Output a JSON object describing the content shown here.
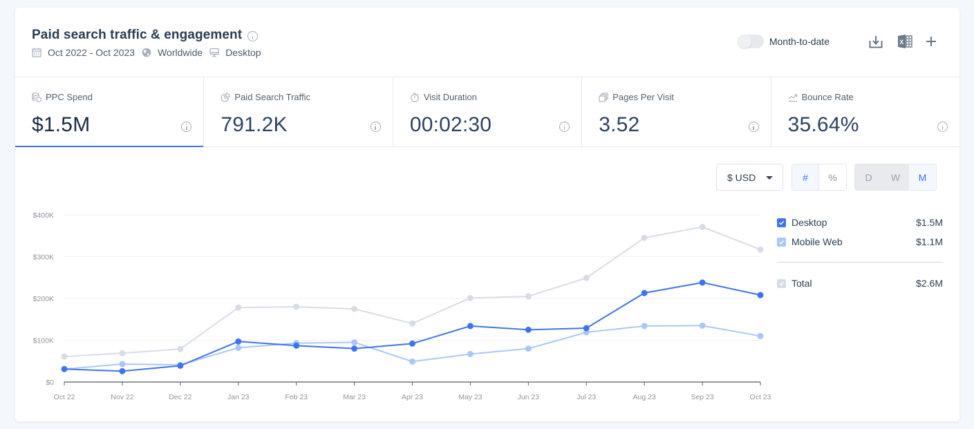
{
  "header": {
    "title": "Paid search traffic & engagement",
    "date_range": "Oct 2022 - Oct 2023",
    "region": "Worldwide",
    "device": "Desktop",
    "toggle_label": "Month-to-date",
    "toggle_on": false,
    "icons": [
      "info-icon",
      "calendar-icon",
      "globe-icon",
      "desktop-icon",
      "download-icon",
      "excel-icon",
      "plus-icon"
    ]
  },
  "metrics": [
    {
      "label": "PPC Spend",
      "value": "$1.5M",
      "icon": "coins-icon",
      "active": true
    },
    {
      "label": "Paid Search Traffic",
      "value": "791.2K",
      "icon": "pie-chart-icon",
      "active": false
    },
    {
      "label": "Visit Duration",
      "value": "00:02:30",
      "icon": "stopwatch-icon",
      "active": false
    },
    {
      "label": "Pages Per Visit",
      "value": "3.52",
      "icon": "pages-icon",
      "active": false
    },
    {
      "label": "Bounce Rate",
      "value": "35.64%",
      "icon": "trend-icon",
      "active": false
    }
  ],
  "controls": {
    "currency": "$ USD",
    "value_mode": [
      {
        "label": "#",
        "active": true
      },
      {
        "label": "%",
        "active": false
      }
    ],
    "granularity": [
      {
        "label": "D",
        "active": false
      },
      {
        "label": "W",
        "active": false
      },
      {
        "label": "M",
        "active": true
      }
    ]
  },
  "legend": [
    {
      "name": "Desktop",
      "value": "$1.5M",
      "checked": true,
      "color": "#3e74f0"
    },
    {
      "name": "Mobile Web",
      "value": "$1.1M",
      "checked": true,
      "color": "#a9c7fa"
    },
    {
      "name": "Total",
      "value": "$2.6M",
      "checked": true,
      "color": "#d8dce6"
    }
  ],
  "chart_data": {
    "type": "line",
    "title": "",
    "xlabel": "",
    "ylabel": "",
    "categories": [
      "Oct 22",
      "Nov 22",
      "Dec 22",
      "Jan 23",
      "Feb 23",
      "Mar 23",
      "Apr 23",
      "May 23",
      "Jun 23",
      "Jul 23",
      "Aug 23",
      "Sep 23",
      "Oct 23"
    ],
    "yticks": [
      0,
      100000,
      200000,
      300000,
      400000
    ],
    "ytick_labels": [
      "$0",
      "$100K",
      "$200K",
      "$300K",
      "$400K"
    ],
    "ylim": [
      0,
      400000
    ],
    "grid": true,
    "legend_position": "right",
    "series": [
      {
        "name": "Total",
        "color": "#d8dce6",
        "values": [
          61000,
          69000,
          79000,
          178000,
          180000,
          175000,
          140000,
          201000,
          205000,
          249000,
          345000,
          371000,
          317000
        ]
      },
      {
        "name": "Mobile Web",
        "color": "#a9c7fa",
        "values": [
          31000,
          43000,
          41000,
          82000,
          93000,
          95000,
          49000,
          67000,
          80000,
          119000,
          134000,
          135000,
          110000
        ]
      },
      {
        "name": "Desktop",
        "color": "#3e74f0",
        "values": [
          31000,
          26000,
          39000,
          97000,
          87000,
          80000,
          92000,
          134000,
          125000,
          129000,
          213000,
          238000,
          208000
        ]
      }
    ]
  }
}
